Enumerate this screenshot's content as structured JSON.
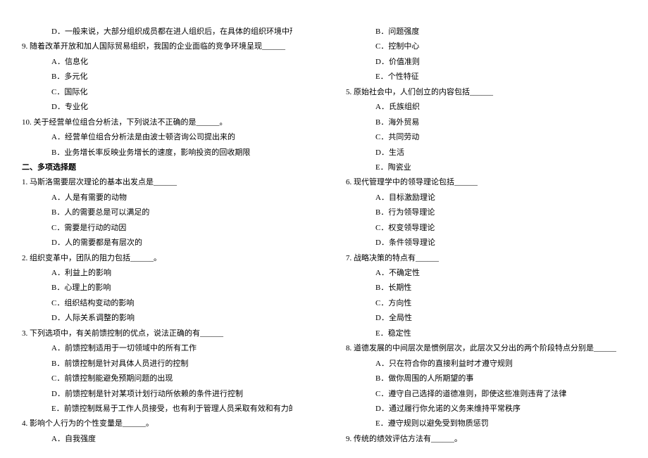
{
  "left": {
    "l1": "D．一般来说，大部分组织成员都在进人组织后，在具体的组织环境中形成相对稳定的价值准则",
    "q9": "9. 随着改革开放和加人国际贸易组织，我国的企业面临的竞争环境呈现______",
    "q9a": "A．信息化",
    "q9b": "B．多元化",
    "q9c": "C．国际化",
    "q9d": "D．专业化",
    "q10": "10. 关于经营单位组合分析法，下列说法不正确的是______。",
    "q10a": "A．经营单位组合分析法是由波士顿咨询公司提出来的",
    "q10b": "B．业务增长率反映业务增长的速度，影响投资的回收期限",
    "sec2": "二、多项选择题",
    "mq1": "1. 马斯洛需要层次理论的基本出发点是______",
    "mq1a": "A．人是有需要的动物",
    "mq1b": "B．人的需要总是可以满足的",
    "mq1c": "C．需要是行动的动因",
    "mq1d": "D．人的需要都是有层次的",
    "mq2": "2. 组织变革中，团队的阻力包括______。",
    "mq2a": "A．利益上的影响",
    "mq2b": "B．心理上的影响",
    "mq2c": "C．组织结构变动的影响",
    "mq2d": "D．人际关系调整的影响",
    "mq3": "3. 下列选项中，有关前馈控制的优点，说法正确的有______",
    "mq3a": "A．前馈控制适用于一切领域中的所有工作",
    "mq3b": "B．前馈控制是针对具体人员进行的控制",
    "mq3c": "C．前馈控制能避免预期问题的出现",
    "mq3d": "D．前馈控制是针对某项计划行动所依赖的条件进行控制",
    "mq3e": "E．前馈控制既易于工作人员接受，也有利于管理人员采取有效和有力的措施改善工作",
    "mq4": "4. 影响个人行为的个性变量是______。",
    "mq4a": "A．自我强度"
  },
  "right": {
    "r1": "B．问题强度",
    "r2": "C．控制中心",
    "r3": "D．价值准则",
    "r4": "E．个性特征",
    "mq5": "5. 原始社会中，人们创立的内容包括______",
    "mq5a": "A．氏族组织",
    "mq5b": "B．海外贸易",
    "mq5c": "C．共同劳动",
    "mq5d": "D．生活",
    "mq5e": "E．陶瓷业",
    "mq6": "6. 现代管理学中的领导理论包括______",
    "mq6a": "A．目标激励理论",
    "mq6b": "B．行为领导理论",
    "mq6c": "C．权变领导理论",
    "mq6d": "D．条件领导理论",
    "mq7": "7. 战略决策的特点有______",
    "mq7a": "A．不确定性",
    "mq7b": "B．长期性",
    "mq7c": "C．方向性",
    "mq7d": "D．全局性",
    "mq7e": "E．稳定性",
    "mq8": "8. 道德发展的中间层次是惯例层次，此层次又分出的两个阶段特点分别是______。",
    "mq8a": "A．只在符合你的直接利益时才遵守规则",
    "mq8b": "B．做你周围的人所期望的事",
    "mq8c": "C．遵守自己选择的道德准则，即使这些准则违背了法律",
    "mq8d": "D．通过履行你允诺的义务来维持平常秩序",
    "mq8e": "E．遵守规则以避免受到物质惩罚",
    "mq9": "9. 传统的绩效评估方法有______。"
  }
}
